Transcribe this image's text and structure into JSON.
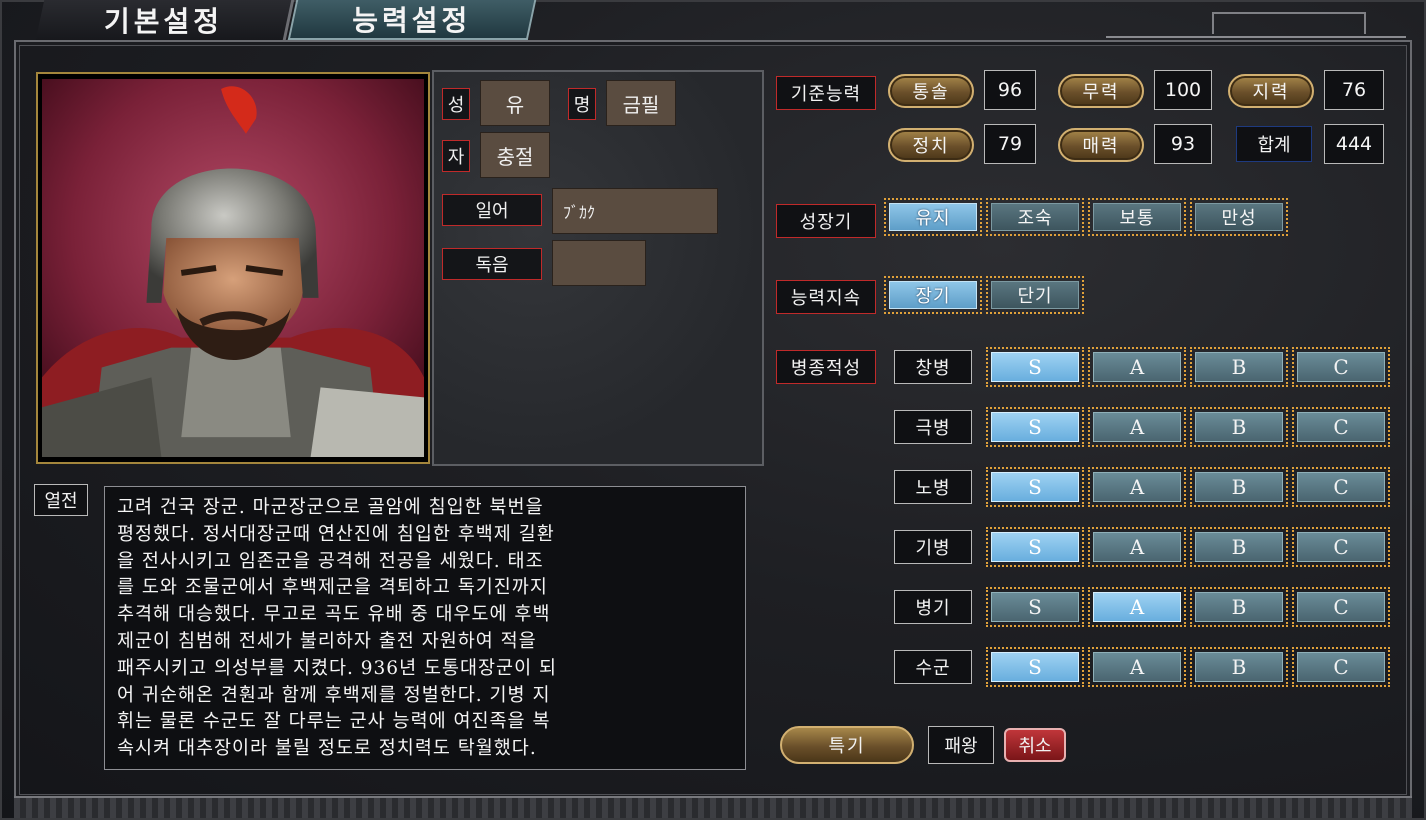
{
  "tabs": [
    {
      "label": "기본설정",
      "active": false
    },
    {
      "label": "능력설정",
      "active": true
    }
  ],
  "name_panel": {
    "surname_label": "성",
    "surname": "유",
    "given_label": "명",
    "given": "금필",
    "style_label": "자",
    "style": "충절",
    "japanese_label": "일어",
    "japanese": "ﾌﾞｶｸ",
    "reading_label": "독음",
    "reading": ""
  },
  "bio": {
    "label": "열전",
    "lines": [
      "고려 건국 장군. 마군장군으로 골암에 침입한 북번을",
      "평정했다. 정서대장군때 연산진에 침입한 후백제 길환",
      "을 전사시키고 임존군을 공격해 전공을 세웠다. 태조",
      "를 도와 조물군에서 후백제군을 격퇴하고 독기진까지",
      "추격해 대승했다. 무고로 곡도 유배 중 대우도에 후백",
      "제군이 침범해 전세가 불리하자 출전 자원하여 적을",
      "패주시키고 의성부를 지켰다. 936년 도통대장군이 되",
      "어 귀순해온 견훤과 함께 후백제를 정벌한다. 기병 지",
      "휘는 물론 수군도 잘 다루는 군사 능력에 여진족을 복",
      "속시켜 대추장이라 불릴 정도로 정치력도 탁월했다."
    ]
  },
  "stats": {
    "label": "기준능력",
    "items": [
      {
        "name": "통솔",
        "value": "96"
      },
      {
        "name": "무력",
        "value": "100"
      },
      {
        "name": "지력",
        "value": "76"
      },
      {
        "name": "정치",
        "value": "79"
      },
      {
        "name": "매력",
        "value": "93"
      }
    ],
    "total_label": "합계",
    "total": "444"
  },
  "growth": {
    "label": "성장기",
    "options": [
      "유지",
      "조숙",
      "보통",
      "만성"
    ],
    "selected": 0
  },
  "sustain": {
    "label": "능력지속",
    "options": [
      "장기",
      "단기"
    ],
    "selected": 0
  },
  "aptitude": {
    "label": "병종적성",
    "grades": [
      "S",
      "A",
      "B",
      "C"
    ],
    "units": [
      {
        "name": "창병",
        "selected": 0
      },
      {
        "name": "극병",
        "selected": 0
      },
      {
        "name": "노병",
        "selected": 0
      },
      {
        "name": "기병",
        "selected": 0
      },
      {
        "name": "병기",
        "selected": 1
      },
      {
        "name": "수군",
        "selected": 0
      }
    ]
  },
  "skill": {
    "button_label": "특기",
    "value": "패왕",
    "cancel_label": "취소"
  },
  "colors": {
    "accent_gold": "#d2b071",
    "label_border_red": "#c02a2a",
    "selected_blue": "#68aede",
    "dotted_border": "#e0a13a"
  }
}
